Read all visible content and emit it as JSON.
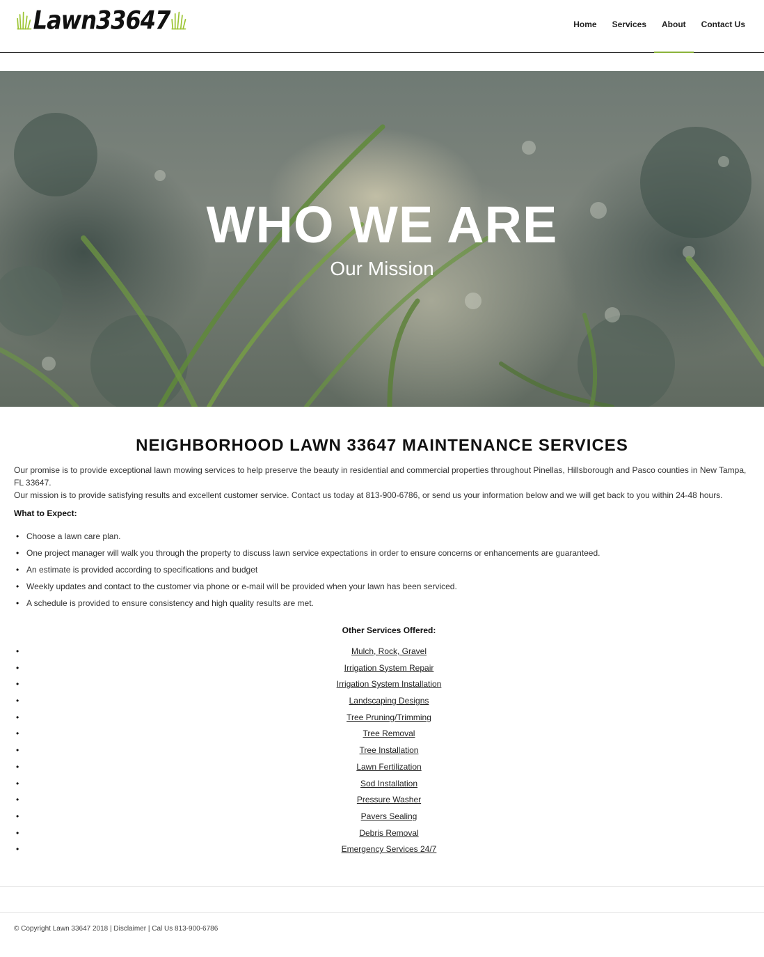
{
  "brand": {
    "logo_text": "Lawn33647",
    "accent_color": "#8bb33a"
  },
  "nav": {
    "items": [
      {
        "label": "Home"
      },
      {
        "label": "Services"
      },
      {
        "label": "About"
      },
      {
        "label": "Contact Us"
      }
    ],
    "active": "About"
  },
  "hero": {
    "title": "WHO WE ARE",
    "subtitle": "Our Mission"
  },
  "main": {
    "heading": "NEIGHBORHOOD LAWN 33647 MAINTENANCE SERVICES",
    "intro_line1": "Our promise is to provide exceptional lawn mowing services to help preserve the beauty in residential and commercial properties throughout Pinellas, Hillsborough and Pasco counties in New Tampa, FL 33647.",
    "intro_line2": "Our mission is to provide satisfying results and excellent customer service. Contact us today at 813-900-6786, or send us your information below and we will get back to you within 24-48 hours.",
    "expect_label": "What to Expect:",
    "expect_items": [
      "Choose a lawn care plan.",
      "One project manager will walk you through the property to discuss lawn service expectations in order to ensure concerns or enhancements are guaranteed.",
      "An estimate is provided according to specifications and budget",
      "Weekly updates and contact to the customer via phone or e-mail will be provided when your lawn has been serviced.",
      "A schedule is provided to ensure consistency and high quality results are met."
    ],
    "other_label": "Other Services Offered:",
    "services": [
      "Mulch, Rock, Gravel",
      "Irrigation System Repair",
      "Irrigation System Installation",
      "Landscaping Designs",
      "Tree Pruning/Trimming",
      "Tree Removal",
      "Tree Installation",
      "Lawn Fertilization",
      "Sod Installation",
      "Pressure Washer",
      "Pavers Sealing",
      "Debris Removal",
      "Emergency Services 24/7"
    ]
  },
  "footer": {
    "text": "© Copyright Lawn 33647 2018 | Disclaimer | Cal Us 813-900-6786"
  }
}
